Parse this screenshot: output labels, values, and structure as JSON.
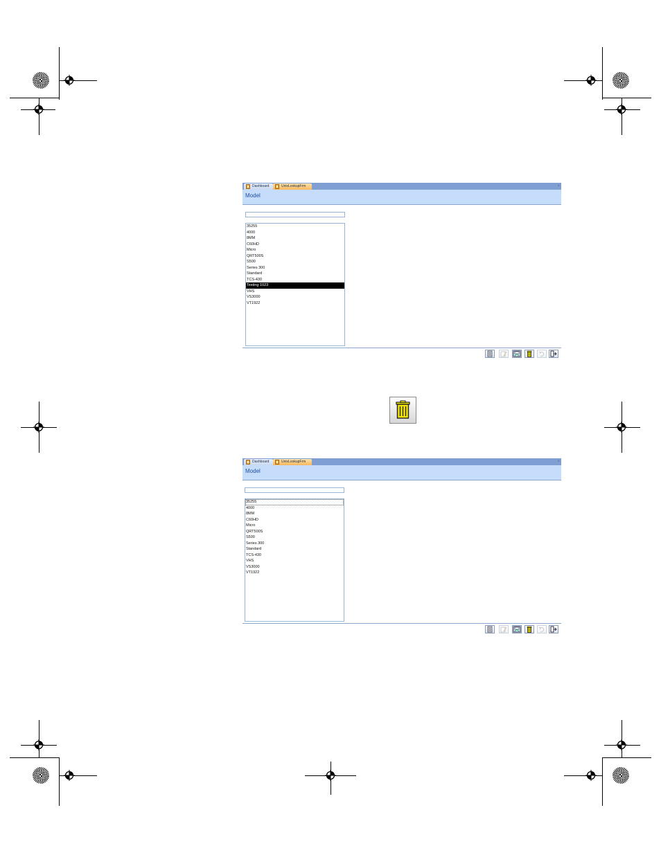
{
  "tabs": {
    "dashboard": "Dashboard",
    "lookup_form": "UnivLookupFrm"
  },
  "close_glyph": "×",
  "form_title": "Model",
  "before_delete": {
    "items": [
      "35255",
      "4000",
      "8MM",
      "C60HD",
      "Micro",
      "QRT500S",
      "S500",
      "Series 300",
      "Standard",
      "TCS-430",
      "Testing 1023",
      "VHS",
      "VS3000",
      "VT1922"
    ],
    "selected_item": "Testing 1023"
  },
  "after_delete": {
    "items": [
      "35255",
      "4000",
      "8MM",
      "C60HD",
      "Micro",
      "QRT500S",
      "S500",
      "Series 300",
      "Standard",
      "TCS-430",
      "VHS",
      "VS3000",
      "VT1922"
    ],
    "focused_item": "35255"
  },
  "toolbar": {
    "buttons": [
      {
        "icon": "new-record-icon",
        "enabled": true
      },
      {
        "icon": "edit-record-icon",
        "enabled": false
      },
      {
        "icon": "save-record-icon",
        "enabled": true
      },
      {
        "icon": "delete-trash-icon",
        "enabled": true
      },
      {
        "icon": "undo-icon",
        "enabled": false
      },
      {
        "icon": "close-form-icon",
        "enabled": true
      }
    ]
  },
  "callout_icon": "delete-trash-icon",
  "colors": {
    "tab_bar": "#7f9ed1",
    "header_band": "#c5dcfb",
    "title_text": "#1f4e9e",
    "active_tab": "#f7b85e",
    "selection": "#000000",
    "trash_yellow": "#f2e600"
  }
}
